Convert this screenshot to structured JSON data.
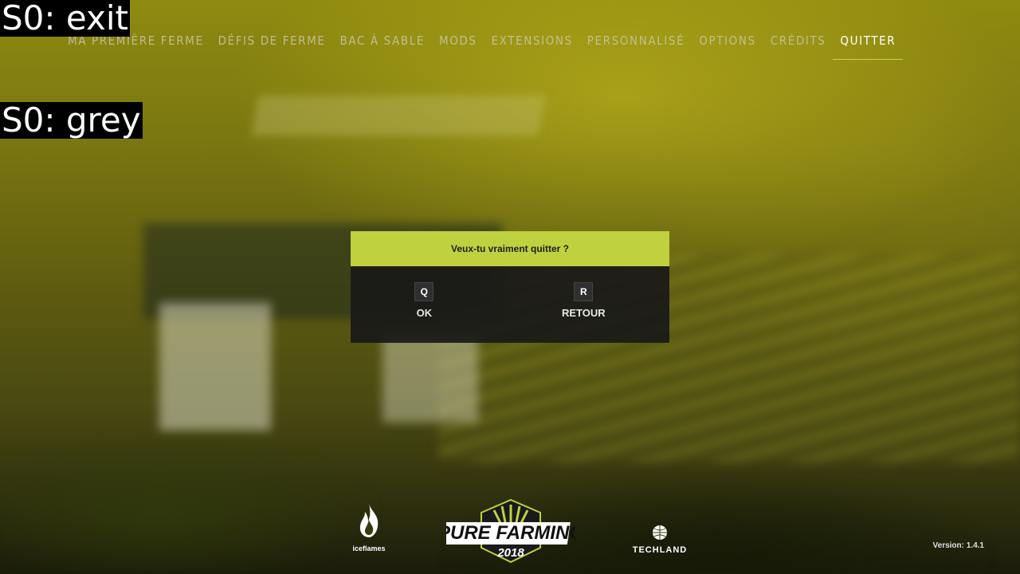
{
  "debug_labels": [
    "S0: exit",
    "S0: grey"
  ],
  "nav": {
    "items": [
      {
        "label": "MA PREMIÈRE FERME"
      },
      {
        "label": "DÉFIS DE FERME"
      },
      {
        "label": "BAC À SABLE"
      },
      {
        "label": "MODS"
      },
      {
        "label": "EXTENSIONS"
      },
      {
        "label": "PERSONNALISÉ"
      },
      {
        "label": "OPTIONS"
      },
      {
        "label": "CRÉDITS"
      },
      {
        "label": "QUITTER"
      }
    ],
    "active": "QUITTER"
  },
  "dialog": {
    "title": "Veux-tu vraiment quitter ?",
    "ok": {
      "key": "Q",
      "label": "OK"
    },
    "back": {
      "key": "R",
      "label": "RETOUR"
    }
  },
  "logos": {
    "iceflames": "iceflames",
    "pure_farming_title": "PURE FARMING",
    "pure_farming_year": "2018",
    "techland": "TECHLAND"
  },
  "version": "Version: 1.4.1",
  "colors": {
    "accent": "#bfd13f",
    "dialog_body": "#191919"
  }
}
